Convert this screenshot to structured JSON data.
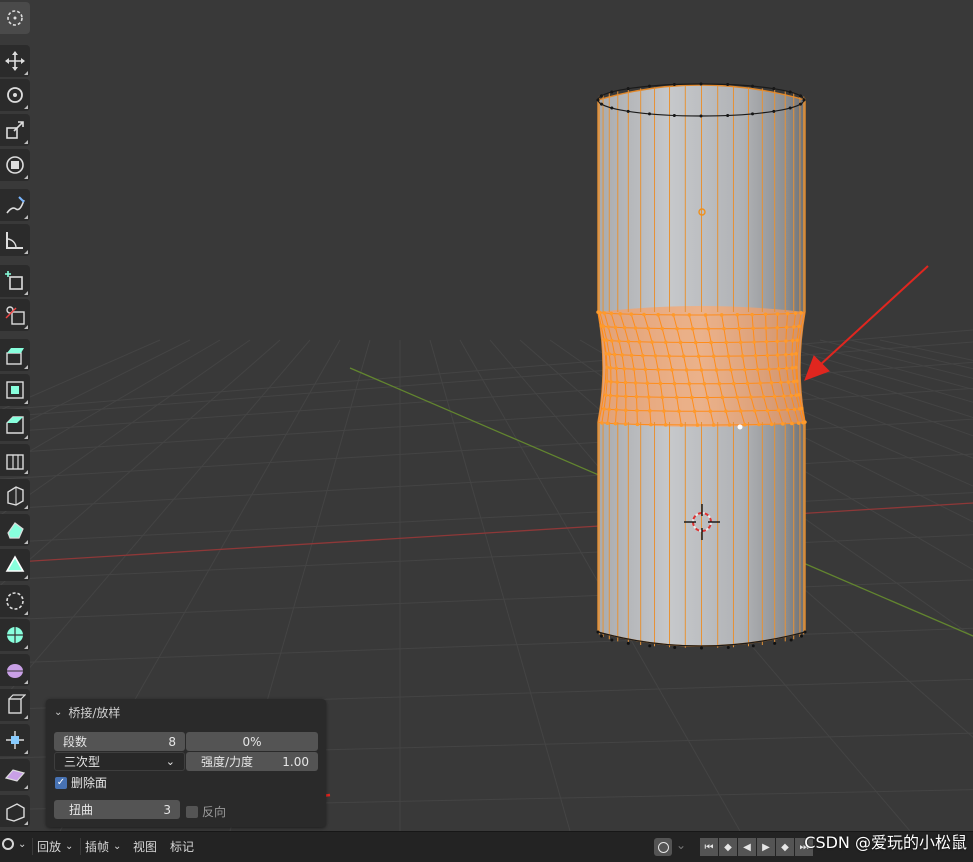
{
  "toolbar": {
    "tools": [
      {
        "name": "cursor-tool",
        "icon": "cursor-icon",
        "active": true
      },
      {
        "name": "move-tool",
        "icon": "move-icon"
      },
      {
        "name": "rotate-tool",
        "icon": "rotate-icon"
      },
      {
        "name": "scale-tool",
        "icon": "scale-icon"
      },
      {
        "name": "transform-tool",
        "icon": "transform-icon"
      },
      {
        "name": "annotate-tool",
        "icon": "annotate-icon"
      },
      {
        "name": "measure-tool",
        "icon": "measure-icon"
      },
      {
        "name": "add-cube-tool",
        "icon": "add-cube-icon"
      },
      {
        "name": "knife-tool",
        "icon": "knife-icon"
      },
      {
        "name": "extrude-tool",
        "icon": "extrude-icon"
      },
      {
        "name": "inset-tool",
        "icon": "inset-icon"
      },
      {
        "name": "bevel-tool",
        "icon": "bevel-icon"
      },
      {
        "name": "loop-cut-tool",
        "icon": "loop-cut-icon"
      },
      {
        "name": "knife-project-tool",
        "icon": "knife-project-icon"
      },
      {
        "name": "poly-build-tool",
        "icon": "poly-build-icon"
      },
      {
        "name": "spin-tool",
        "icon": "spin-icon"
      },
      {
        "name": "smooth-tool",
        "icon": "smooth-icon"
      },
      {
        "name": "edge-slide-tool",
        "icon": "edge-slide-icon"
      },
      {
        "name": "shrink-fatten-tool",
        "icon": "shrink-fatten-icon"
      },
      {
        "name": "shear-tool",
        "icon": "shear-icon"
      },
      {
        "name": "to-sphere-tool",
        "icon": "to-sphere-icon"
      },
      {
        "name": "rip-tool",
        "icon": "rip-icon"
      },
      {
        "name": "rip-region-tool",
        "icon": "rip-region-icon"
      }
    ]
  },
  "operator_panel": {
    "title": "桥接/放样",
    "segments_label": "段数",
    "segments_value": "8",
    "blend_value": "0%",
    "interpolation": "三次型",
    "strength_label": "强度/力度",
    "strength_value": "1.00",
    "delete_faces_label": "删除面",
    "delete_faces": true,
    "twist_label": "扭曲",
    "twist_value": "3",
    "reverse_label": "反向",
    "reverse": false
  },
  "bottom_bar": {
    "playback": "回放",
    "keying": "插帧",
    "view": "视图",
    "marker": "标记"
  },
  "watermark": "CSDN @爱玩的小松鼠",
  "colors": {
    "background": "#393939",
    "selection_orange": "#ff8c1a",
    "annotation_arrow": "#e0261f",
    "x_axis": "#9a3a3a",
    "y_axis": "#6a8f32"
  }
}
